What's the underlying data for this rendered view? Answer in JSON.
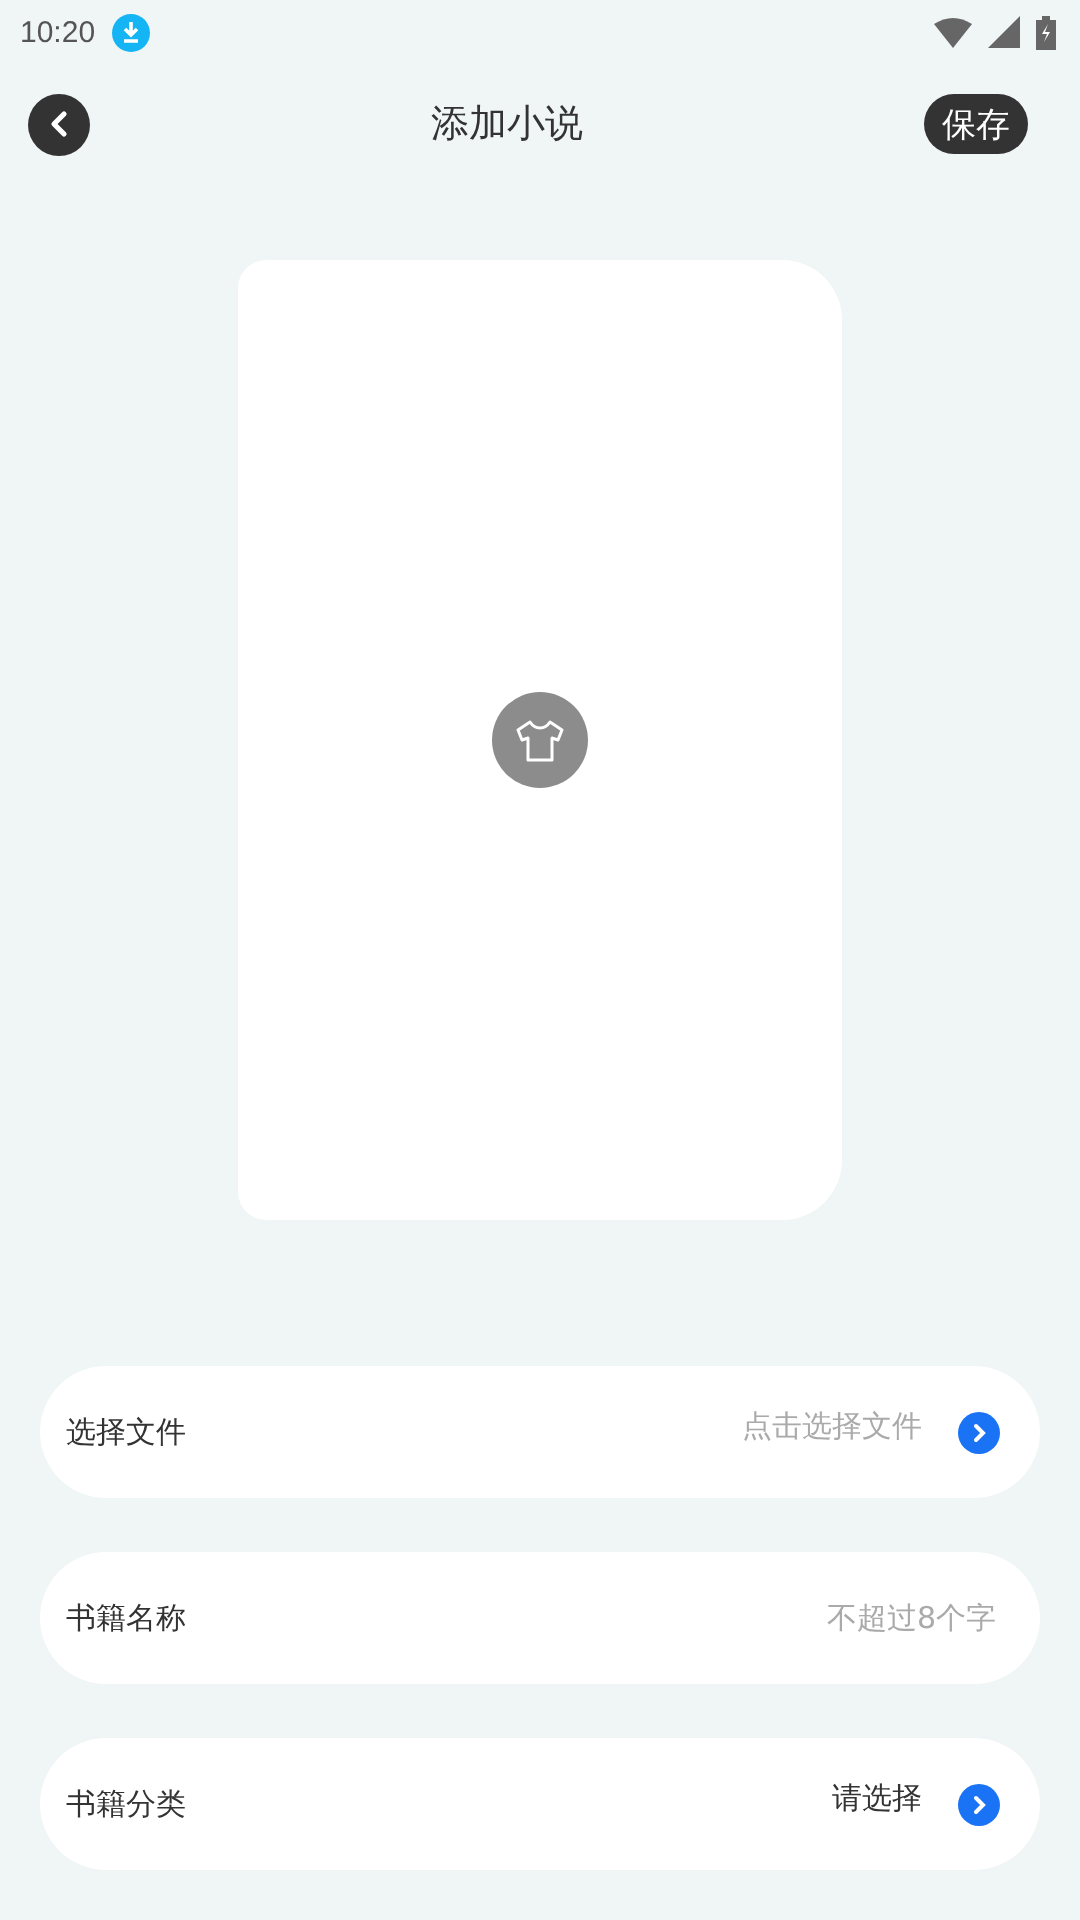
{
  "status_bar": {
    "time": "10:20"
  },
  "header": {
    "title": "添加小说",
    "save_button": "保存"
  },
  "fields": [
    {
      "kind": "select",
      "label": "选择文件",
      "placeholder": "点击选择文件"
    },
    {
      "kind": "input",
      "label": "书籍名称",
      "placeholder": "不超过8个字"
    },
    {
      "kind": "select",
      "label": "书籍分类",
      "value": "请选择"
    }
  ]
}
